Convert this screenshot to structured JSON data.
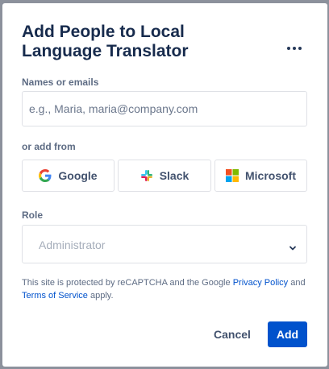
{
  "dialog": {
    "title": "Add People to Local Language Translator",
    "more_icon": "more-horizontal-icon"
  },
  "names": {
    "label": "Names or emails",
    "placeholder": "e.g., Maria, maria@company.com",
    "value": ""
  },
  "providers": {
    "label": "or add from",
    "items": [
      {
        "label": "Google",
        "icon": "google-icon"
      },
      {
        "label": "Slack",
        "icon": "slack-icon"
      },
      {
        "label": "Microsoft",
        "icon": "microsoft-icon"
      }
    ]
  },
  "role": {
    "label": "Role",
    "placeholder": "Administrator",
    "icon": "chevron-down-icon"
  },
  "notice": {
    "prefix": "This site is protected by reCAPTCHA and the Google ",
    "privacy_link": "Privacy Policy",
    "middle": " and ",
    "terms_link": "Terms of Service",
    "suffix": " apply."
  },
  "actions": {
    "cancel": "Cancel",
    "add": "Add"
  },
  "colors": {
    "primary": "#0052cc",
    "title": "#172b4d",
    "label": "#5e6c84",
    "border": "#dfe1e6",
    "overlay": "#8c919c"
  }
}
